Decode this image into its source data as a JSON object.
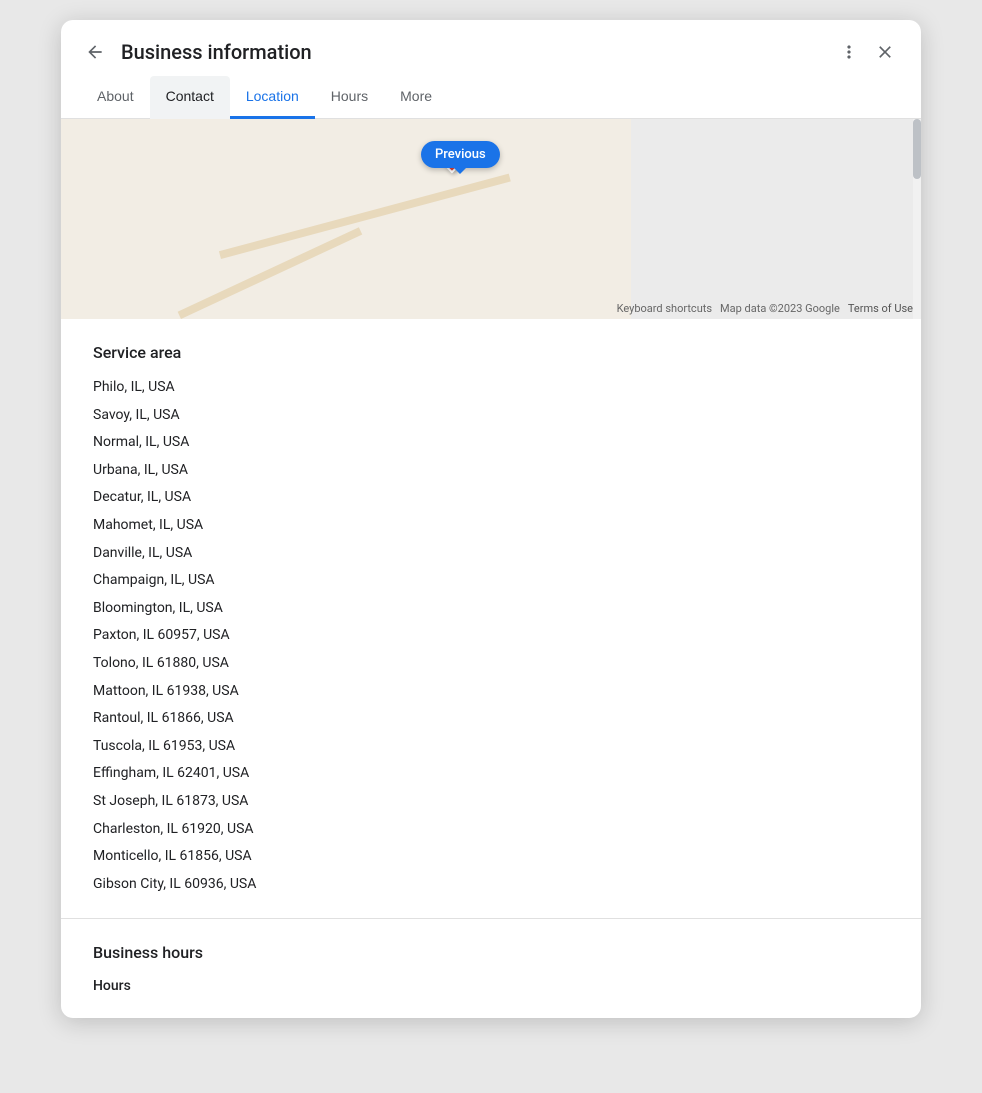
{
  "dialog": {
    "title": "Business information",
    "back_label": "←",
    "more_label": "⋮",
    "close_label": "✕"
  },
  "tabs": [
    {
      "id": "about",
      "label": "About",
      "active": false,
      "selected": false
    },
    {
      "id": "contact",
      "label": "Contact",
      "active": false,
      "selected": true
    },
    {
      "id": "location",
      "label": "Location",
      "active": true,
      "selected": false
    },
    {
      "id": "hours",
      "label": "Hours",
      "active": false,
      "selected": false
    },
    {
      "id": "more",
      "label": "More",
      "active": false,
      "selected": false
    }
  ],
  "map": {
    "tooltip_label": "Previous",
    "keyboard_shortcuts": "Keyboard shortcuts",
    "map_data": "Map data ©2023 Google",
    "terms_of_use": "Terms of Use"
  },
  "service_area": {
    "title": "Service area",
    "locations": [
      "Philo, IL, USA",
      "Savoy, IL, USA",
      "Normal, IL, USA",
      "Urbana, IL, USA",
      "Decatur, IL, USA",
      "Mahomet, IL, USA",
      "Danville, IL, USA",
      "Champaign, IL, USA",
      "Bloomington, IL, USA",
      "Paxton, IL 60957, USA",
      "Tolono, IL 61880, USA",
      "Mattoon, IL 61938, USA",
      "Rantoul, IL 61866, USA",
      "Tuscola, IL 61953, USA",
      "Effingham, IL 62401, USA",
      "St Joseph, IL 61873, USA",
      "Charleston, IL 61920, USA",
      "Monticello, IL 61856, USA",
      "Gibson City, IL 60936, USA"
    ]
  },
  "business_hours": {
    "title": "Business hours",
    "sub_label": "Hours"
  }
}
